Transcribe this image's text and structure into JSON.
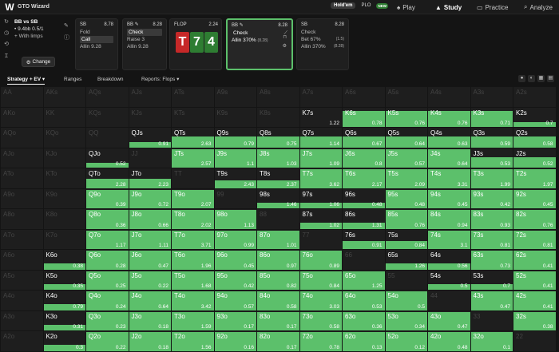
{
  "app": {
    "title": "GTO Wizard",
    "logo": "W"
  },
  "game_toggle": {
    "holdem": "Hold'em",
    "plo": "PLO",
    "new_badge": "NEW"
  },
  "nav": [
    {
      "label": "Play",
      "icon": "spade"
    },
    {
      "label": "Study",
      "icon": "study-hat",
      "active": true
    },
    {
      "label": "Practice",
      "icon": "cards"
    },
    {
      "label": "Analyze",
      "icon": "magnifier"
    }
  ],
  "spot": {
    "title": "BB vs SB",
    "stack": "9.4bb 0.5/1",
    "limps": "With limps",
    "change_label": "Change"
  },
  "cards": [
    {
      "pos": "SB",
      "pot": "8.78",
      "actions": [
        "Fold",
        "Call",
        "Allin 9.28"
      ],
      "selected": 1
    },
    {
      "pos": "BB",
      "pot": "8.28",
      "actions": [
        "Check",
        "Raise 3",
        "Allin 9.28"
      ],
      "selected": 0
    },
    {
      "pos": "BB",
      "pot": "8.28",
      "actions": [
        "Check",
        "Allin 370%"
      ],
      "sub": "(8.28)",
      "selected": 0,
      "active": true
    },
    {
      "pos": "SB",
      "pot": "8.28",
      "actions": [
        "Check",
        "Bet 67%",
        "Allin 370%"
      ],
      "subs": [
        "",
        "(1.5)",
        "(8.28)"
      ]
    }
  ],
  "flop": {
    "label": "FLOP",
    "pot": "2.24",
    "cards": [
      {
        "rank": "T",
        "color": "#c62828"
      },
      {
        "rank": "7",
        "color": "#2e7d32"
      },
      {
        "rank": "4",
        "color": "#2e7d32"
      }
    ]
  },
  "subtabs": {
    "strategy": "Strategy + EV",
    "ranges": "Ranges",
    "breakdown": "Breakdown",
    "reports": "Reports: Flops"
  },
  "grid": [
    [
      [
        "AA",
        "",
        0
      ],
      [
        "AKs",
        "",
        0
      ],
      [
        "AQs",
        "",
        0
      ],
      [
        "AJs",
        "",
        0
      ],
      [
        "ATs",
        "",
        0
      ],
      [
        "A9s",
        "",
        0
      ],
      [
        "A8s",
        "",
        0
      ],
      [
        "A7s",
        "",
        0
      ],
      [
        "A6s",
        "",
        0
      ],
      [
        "A5s",
        "",
        0
      ],
      [
        "A4s",
        "",
        0
      ],
      [
        "A3s",
        "",
        0
      ],
      [
        "A2s",
        "",
        0
      ]
    ],
    [
      [
        "AKo",
        "",
        0
      ],
      [
        "KK",
        "",
        0
      ],
      [
        "KQs",
        "",
        0
      ],
      [
        "KJs",
        "",
        0
      ],
      [
        "KTs",
        "",
        0
      ],
      [
        "K9s",
        "",
        0
      ],
      [
        "K8s",
        "",
        0
      ],
      [
        "K7s",
        "1.22",
        0
      ],
      [
        "K6s",
        "0.78",
        0.8
      ],
      [
        "K5s",
        "0.76",
        0.8
      ],
      [
        "K4s",
        "0.76",
        0.8
      ],
      [
        "K3s",
        "0.71",
        0.8
      ],
      [
        "K2s",
        "0.7",
        0.25
      ]
    ],
    [
      [
        "AQo",
        "",
        0
      ],
      [
        "KQo",
        "",
        0
      ],
      [
        "QQ",
        "",
        0
      ],
      [
        "QJs",
        "0.91",
        0.25
      ],
      [
        "QTs",
        "2.63",
        0.55
      ],
      [
        "Q9s",
        "0.79",
        0.55
      ],
      [
        "Q8s",
        "0.75",
        0.55
      ],
      [
        "Q7s",
        "1.14",
        0.55
      ],
      [
        "Q6s",
        "0.67",
        0.55
      ],
      [
        "Q5s",
        "0.64",
        0.55
      ],
      [
        "Q4s",
        "0.63",
        0.55
      ],
      [
        "Q3s",
        "0.59",
        0.55
      ],
      [
        "Q2s",
        "0.58",
        0.55
      ]
    ],
    [
      [
        "AJo",
        "",
        0
      ],
      [
        "KJo",
        "",
        0
      ],
      [
        "QJo",
        "0.52",
        0.25
      ],
      [
        "JJ",
        "",
        0
      ],
      [
        "JTs",
        "2.57",
        0.95
      ],
      [
        "J9s",
        "1.1",
        0.95
      ],
      [
        "J8s",
        "1.03",
        0.95
      ],
      [
        "J7s",
        "1.09",
        0.95
      ],
      [
        "J6s",
        "0.8",
        0.95
      ],
      [
        "J5s",
        "0.57",
        0.95
      ],
      [
        "J4s",
        "0.64",
        0.95
      ],
      [
        "J3s",
        "0.53",
        0.55
      ],
      [
        "J2s",
        "0.52",
        0.55
      ]
    ],
    [
      [
        "ATo",
        "",
        0
      ],
      [
        "KTo",
        "",
        0
      ],
      [
        "QTo",
        "2.28",
        0.45
      ],
      [
        "JTo",
        "2.23",
        0.45
      ],
      [
        "TT",
        "",
        0
      ],
      [
        "T9s",
        "2.43",
        0.4
      ],
      [
        "T8s",
        "2.37",
        0.4
      ],
      [
        "T7s",
        "3.62",
        0.95
      ],
      [
        "T6s",
        "2.17",
        0.95
      ],
      [
        "T5s",
        "2.09",
        0.95
      ],
      [
        "T4s",
        "3.31",
        0.95
      ],
      [
        "T3s",
        "1.99",
        0.95
      ],
      [
        "T2s",
        "1.97",
        0.95
      ]
    ],
    [
      [
        "A9o",
        "",
        0
      ],
      [
        "K9o",
        "",
        0
      ],
      [
        "Q9o",
        "0.39",
        0.95
      ],
      [
        "J9o",
        "0.72",
        0.95
      ],
      [
        "T9o",
        "2.07",
        0.95
      ],
      [
        "99",
        "",
        0
      ],
      [
        "98s",
        "1.46",
        0.3
      ],
      [
        "97s",
        "1.06",
        0.3
      ],
      [
        "96s",
        "0.48",
        0.3
      ],
      [
        "95s",
        "0.48",
        0.95
      ],
      [
        "94s",
        "0.45",
        0.95
      ],
      [
        "93s",
        "0.42",
        0.95
      ],
      [
        "92s",
        "0.45",
        0.95
      ]
    ],
    [
      [
        "A8o",
        "",
        0
      ],
      [
        "K8o",
        "",
        0
      ],
      [
        "Q8o",
        "0.36",
        0.95
      ],
      [
        "J8o",
        "0.66",
        0.95
      ],
      [
        "T8o",
        "2.02",
        0.95
      ],
      [
        "98o",
        "1.13",
        0.95
      ],
      [
        "88",
        "",
        0
      ],
      [
        "87s",
        "1.02",
        0.3
      ],
      [
        "86s",
        "1.31",
        0.3
      ],
      [
        "85s",
        "0.76",
        0.95
      ],
      [
        "84s",
        "0.94",
        0.95
      ],
      [
        "83s",
        "0.93",
        0.95
      ],
      [
        "82s",
        "0.76",
        0.95
      ]
    ],
    [
      [
        "A7o",
        "",
        0
      ],
      [
        "K7o",
        "",
        0
      ],
      [
        "Q7o",
        "1.17",
        0.95
      ],
      [
        "J7o",
        "1.11",
        0.95
      ],
      [
        "T7o",
        "3.71",
        0.95
      ],
      [
        "97o",
        "0.99",
        0.95
      ],
      [
        "87o",
        "1.01",
        0.95
      ],
      [
        "77",
        "",
        0
      ],
      [
        "76s",
        "0.91",
        0.4
      ],
      [
        "75s",
        "0.84",
        0.4
      ],
      [
        "74s",
        "3.1",
        0.95
      ],
      [
        "73s",
        "0.81",
        0.95
      ],
      [
        "72s",
        "0.81",
        0.95
      ]
    ],
    [
      [
        "A6o",
        "",
        0
      ],
      [
        "K6o",
        "0.38",
        0.3
      ],
      [
        "Q6o",
        "0.28",
        0.95
      ],
      [
        "J6o",
        "0.47",
        0.95
      ],
      [
        "T6o",
        "1.96",
        0.95
      ],
      [
        "96o",
        "0.45",
        0.95
      ],
      [
        "86o",
        "0.97",
        0.95
      ],
      [
        "76o",
        "0.89",
        0.95
      ],
      [
        "66",
        "",
        0
      ],
      [
        "65s",
        "1.26",
        0.3
      ],
      [
        "64s",
        "0.56",
        0.3
      ],
      [
        "63s",
        "0.73",
        0.95
      ],
      [
        "62s",
        "0.41",
        0.95
      ]
    ],
    [
      [
        "A5o",
        "",
        0
      ],
      [
        "K5o",
        "0.35",
        0.3
      ],
      [
        "Q5o",
        "0.25",
        0.95
      ],
      [
        "J5o",
        "0.22",
        0.95
      ],
      [
        "T5o",
        "1.68",
        0.95
      ],
      [
        "95o",
        "0.42",
        0.95
      ],
      [
        "85o",
        "0.82",
        0.95
      ],
      [
        "75o",
        "0.84",
        0.95
      ],
      [
        "65o",
        "1.25",
        0.95
      ],
      [
        "55",
        "",
        0
      ],
      [
        "54s",
        "0.5",
        0.3
      ],
      [
        "53s",
        "0.7",
        0.3
      ],
      [
        "52s",
        "0.41",
        0.95
      ]
    ],
    [
      [
        "A4o",
        "",
        0
      ],
      [
        "K4o",
        "0.79",
        0.3
      ],
      [
        "Q4o",
        "0.24",
        0.95
      ],
      [
        "J4o",
        "0.64",
        0.95
      ],
      [
        "T4o",
        "3.42",
        0.95
      ],
      [
        "94o",
        "0.57",
        0.95
      ],
      [
        "84o",
        "0.58",
        0.95
      ],
      [
        "74o",
        "3.03",
        0.95
      ],
      [
        "64o",
        "0.53",
        0.95
      ],
      [
        "54o",
        "0.5",
        0.95
      ],
      [
        "44",
        "",
        0
      ],
      [
        "43s",
        "0.47",
        0.95
      ],
      [
        "42s",
        "0.41",
        0.95
      ]
    ],
    [
      [
        "A3o",
        "",
        0
      ],
      [
        "K3o",
        "0.31",
        0.3
      ],
      [
        "Q3o",
        "0.23",
        0.95
      ],
      [
        "J3o",
        "0.18",
        0.95
      ],
      [
        "T3o",
        "1.59",
        0.95
      ],
      [
        "93o",
        "0.17",
        0.95
      ],
      [
        "83o",
        "0.17",
        0.95
      ],
      [
        "73o",
        "0.58",
        0.95
      ],
      [
        "63o",
        "0.36",
        0.95
      ],
      [
        "53o",
        "0.34",
        0.95
      ],
      [
        "43o",
        "0.47",
        0.95
      ],
      [
        "33",
        "",
        0
      ],
      [
        "32s",
        "0.38",
        0.95
      ]
    ],
    [
      [
        "A2o",
        "",
        0
      ],
      [
        "K2o",
        "0.3",
        0.3
      ],
      [
        "Q2o",
        "0.22",
        0.95
      ],
      [
        "J2o",
        "0.18",
        0.95
      ],
      [
        "T2o",
        "1.56",
        0.95
      ],
      [
        "92o",
        "0.16",
        0.95
      ],
      [
        "82o",
        "0.17",
        0.95
      ],
      [
        "72o",
        "0.78",
        0.95
      ],
      [
        "62o",
        "0.13",
        0.95
      ],
      [
        "52o",
        "0.12",
        0.95
      ],
      [
        "42o",
        "0.48",
        0.95
      ],
      [
        "32o",
        "0.1",
        0.95
      ],
      [
        "22",
        "",
        0
      ]
    ]
  ],
  "colors": {
    "accent": "#5cc06b",
    "background": "#141414"
  }
}
